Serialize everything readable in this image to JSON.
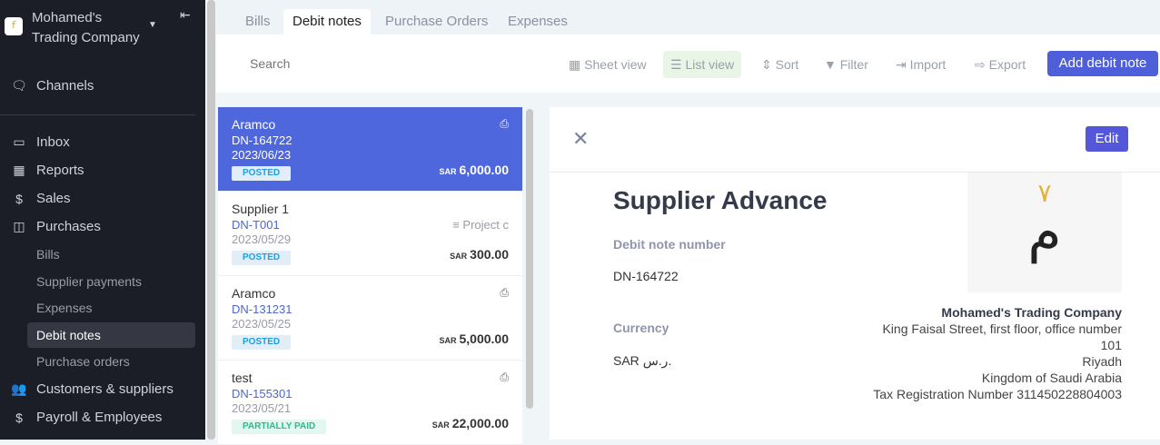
{
  "sidebar": {
    "company": "Mohamed's\nTrading Company",
    "company_line1": "Mohamed's",
    "company_line2": "Trading Company",
    "items": [
      {
        "label": "Channels",
        "icon": "chat-icon"
      },
      {
        "label": "Inbox",
        "icon": "inbox-icon"
      },
      {
        "label": "Reports",
        "icon": "chart-icon"
      },
      {
        "label": "Sales",
        "icon": "dollar-icon"
      },
      {
        "label": "Purchases",
        "icon": "bag-icon"
      }
    ],
    "purchases_sub": [
      "Bills",
      "Supplier payments",
      "Expenses",
      "Debit notes",
      "Purchase orders"
    ],
    "bottom": [
      {
        "label": "Customers & suppliers",
        "icon": "users-icon"
      },
      {
        "label": "Payroll & Employees",
        "icon": "payroll-icon"
      }
    ]
  },
  "tabs": [
    "Bills",
    "Debit notes",
    "Purchase Orders",
    "Expenses"
  ],
  "toolbar": {
    "search_placeholder": "Search",
    "sheet_view": "Sheet view",
    "list_view": "List view",
    "sort": "Sort",
    "filter": "Filter",
    "import": "Import",
    "export": "Export",
    "add": "Add debit note"
  },
  "list": [
    {
      "name": "Aramco",
      "number": "DN-164722",
      "date": "2023/06/23",
      "status": "POSTED",
      "currency": "SAR",
      "amount": "6,000.00"
    },
    {
      "name": "Supplier 1",
      "number": "DN-T001",
      "date": "2023/05/29",
      "status": "POSTED",
      "currency": "SAR",
      "amount": "300.00",
      "project": "≡ Project c"
    },
    {
      "name": "Aramco",
      "number": "DN-131231",
      "date": "2023/05/25",
      "status": "POSTED",
      "currency": "SAR",
      "amount": "5,000.00"
    },
    {
      "name": "test",
      "number": "DN-155301",
      "date": "2023/05/21",
      "status": "PARTIALLY PAID",
      "currency": "SAR",
      "amount": "22,000.00"
    }
  ],
  "detail": {
    "edit": "Edit",
    "title": "Supplier Advance",
    "number_label": "Debit note number",
    "number": "DN-164722",
    "currency_label": "Currency",
    "currency": "SAR ر.س.",
    "company": "Mohamed's Trading Company",
    "address": [
      "King Faisal Street, first floor, office number",
      "101",
      "Riyadh",
      "Kingdom of Saudi Arabia",
      "Tax Registration Number 311450228804003"
    ]
  },
  "colors": {
    "sidebar": "#1b1d27",
    "accent": "#4f5fd9",
    "selected": "#4f67dc"
  }
}
